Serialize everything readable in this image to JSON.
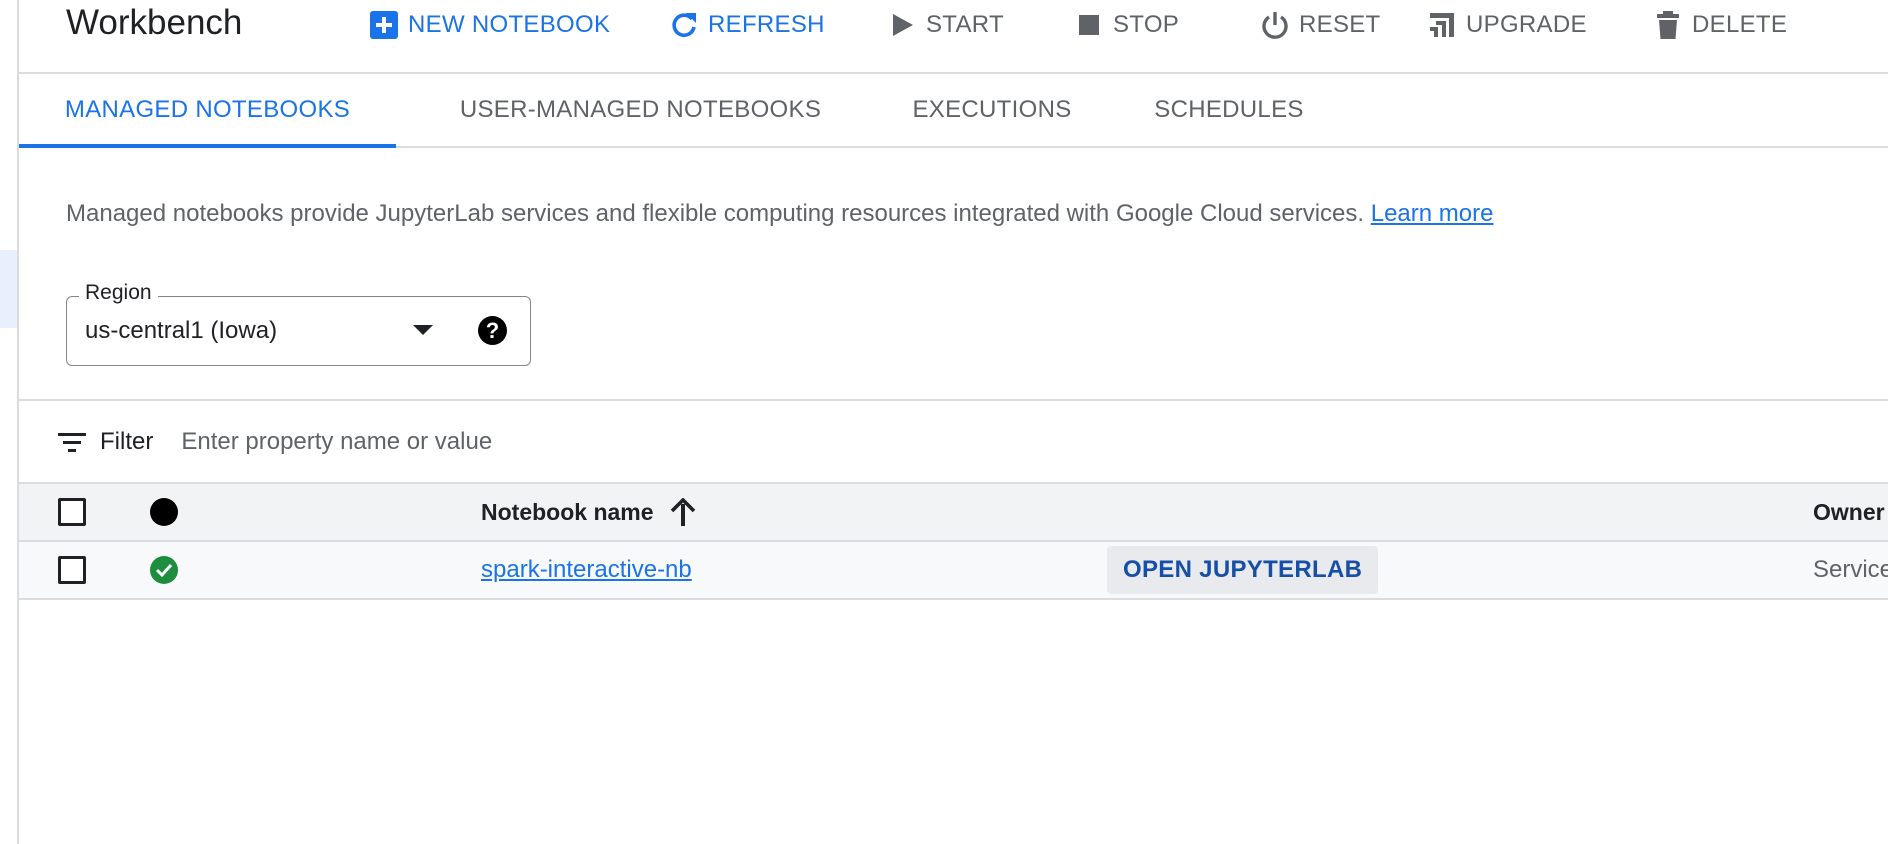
{
  "app": {
    "title": "Workbench"
  },
  "toolbar": {
    "new_notebook": "NEW NOTEBOOK",
    "refresh": "REFRESH",
    "start": "START",
    "stop": "STOP",
    "reset": "RESET",
    "upgrade": "UPGRADE",
    "delete": "DELETE"
  },
  "tabs": [
    {
      "label": "MANAGED NOTEBOOKS",
      "selected": true
    },
    {
      "label": "USER-MANAGED NOTEBOOKS",
      "selected": false
    },
    {
      "label": "EXECUTIONS",
      "selected": false
    },
    {
      "label": "SCHEDULES",
      "selected": false
    }
  ],
  "description": {
    "text": "Managed notebooks provide JupyterLab services and flexible computing resources integrated with Google Cloud services.",
    "link": "Learn more"
  },
  "region": {
    "label": "Region",
    "value": "us-central1 (Iowa)",
    "help_icon": "help-icon"
  },
  "filter": {
    "label": "Filter",
    "placeholder": "Enter property name or value"
  },
  "table": {
    "columns": {
      "name": "Notebook name",
      "owner": "Owner"
    },
    "rows": [
      {
        "name": "spark-interactive-nb",
        "status": "running",
        "action": "OPEN JUPYTERLAB",
        "owner": "Service"
      }
    ]
  },
  "colors": {
    "accent": "#1a73e8",
    "status_ok": "#1e8e3e",
    "text_secondary": "#5f6368"
  }
}
